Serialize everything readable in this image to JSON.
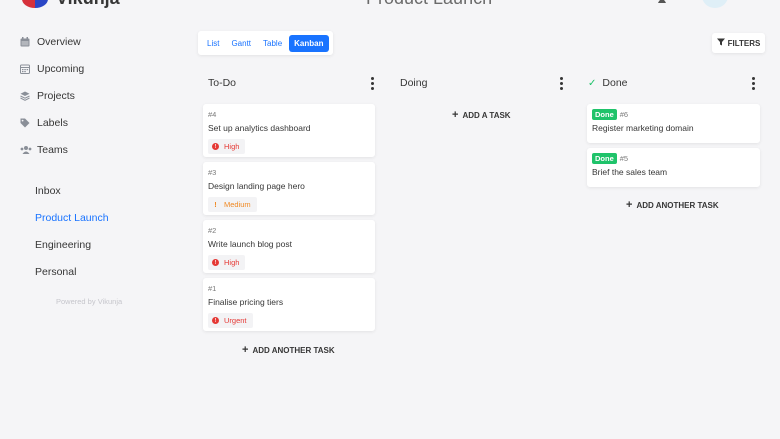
{
  "header": {
    "brand": "Vikunja",
    "title": "Product Launch"
  },
  "sidebar": {
    "nav": [
      {
        "label": "Overview",
        "icon": "calendar-icon"
      },
      {
        "label": "Upcoming",
        "icon": "calendar-grid-icon"
      },
      {
        "label": "Projects",
        "icon": "layers-icon"
      },
      {
        "label": "Labels",
        "icon": "tags-icon"
      },
      {
        "label": "Teams",
        "icon": "users-icon"
      }
    ],
    "projects": [
      {
        "label": "Inbox"
      },
      {
        "label": "Product Launch",
        "active": true
      },
      {
        "label": "Engineering"
      },
      {
        "label": "Personal"
      }
    ],
    "powered_by": "Powered by Vikunja"
  },
  "views": {
    "list": "List",
    "gantt": "Gantt",
    "table": "Table",
    "kanban": "Kanban",
    "active": "Kanban"
  },
  "filters_label": "FILTERS",
  "columns": [
    {
      "title": "To-Do",
      "add_label": "ADD ANOTHER TASK",
      "cards": [
        {
          "id": "#4",
          "title": "Set up analytics dashboard",
          "priority": "High"
        },
        {
          "id": "#3",
          "title": "Design landing page hero",
          "priority": "Medium"
        },
        {
          "id": "#2",
          "title": "Write launch blog post",
          "priority": "High"
        },
        {
          "id": "#1",
          "title": "Finalise pricing tiers",
          "priority": "Urgent"
        }
      ]
    },
    {
      "title": "Doing",
      "add_label": "ADD A TASK",
      "cards": []
    },
    {
      "title": "Done",
      "add_label": "ADD ANOTHER TASK",
      "cards": [
        {
          "tag": "Done",
          "id": "#6",
          "title": "Register marketing domain"
        },
        {
          "tag": "Done",
          "id": "#5",
          "title": "Brief the sales team"
        }
      ]
    }
  ],
  "colors": {
    "accent": "#1973ff",
    "done": "#1fc36a",
    "danger": "#e53935",
    "warning": "#f08a24"
  }
}
